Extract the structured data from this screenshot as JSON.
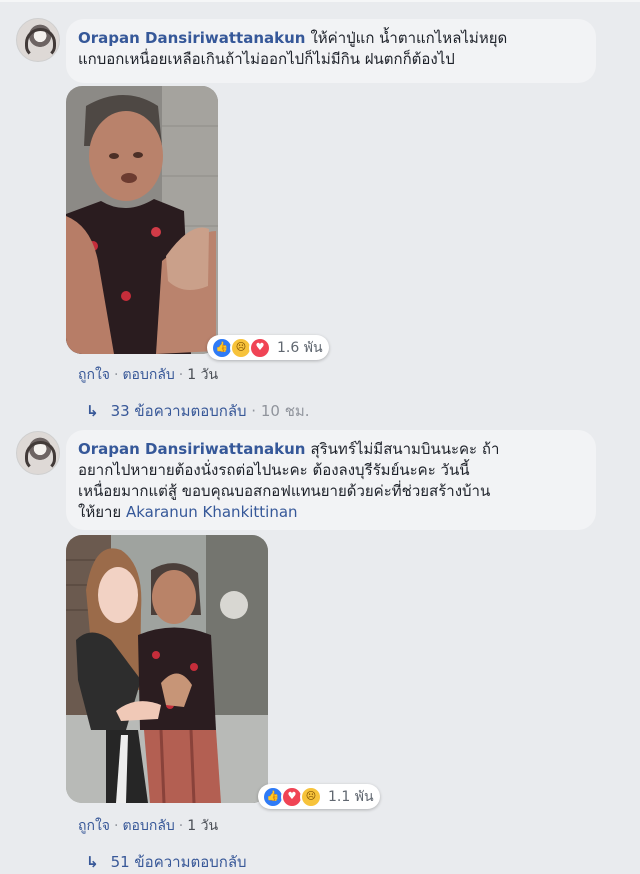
{
  "comments": [
    {
      "author": "Orapan Dansiriwattanakun",
      "text_line1": "ให้ค่าปู่แก น้ำตาแกไหลไม่หยุด",
      "text_line2": "แกบอกเหนื่อยเหลือเกินถ้าไม่ออกไปก็ไม่มีกิน ฝนตกก็ต้องไป",
      "reactions_count": "1.6 พัน",
      "reaction_icons": [
        "like-icon",
        "sad-icon",
        "love-icon"
      ],
      "action_like": "ถูกใจ",
      "action_reply": "ตอบกลับ",
      "timestamp": "1 วัน",
      "replies_text": "33 ข้อความตอบกลับ",
      "replies_time": "10 ชม."
    },
    {
      "author": "Orapan Dansiriwattanakun",
      "text_line1": "สุรินทร์ไม่มีสนามบินนะคะ ถ้า",
      "text_line2": "อยากไปหายายต้องนั่งรถต่อไปนะคะ ต้องลงบุรีรัมย์นะคะ วันนี้",
      "text_line3": "เหนื่อยมากแต่สู้ ขอบคุณบอสกอฟแทนยายด้วยค่ะที่ช่วยสร้างบ้าน",
      "text_line4_prefix": "ให้ยาย",
      "tagged_name": "Akaranun Khankittinan",
      "reactions_count": "1.1 พัน",
      "reaction_icons": [
        "like-icon",
        "love-icon",
        "sad-icon"
      ],
      "action_like": "ถูกใจ",
      "action_reply": "ตอบกลับ",
      "timestamp": "1 วัน",
      "replies_text": "51 ข้อความตอบกลับ"
    }
  ],
  "colors": {
    "author": "#365899",
    "link": "#385898",
    "background": "#e9ebee",
    "bubble": "#f2f3f5"
  }
}
